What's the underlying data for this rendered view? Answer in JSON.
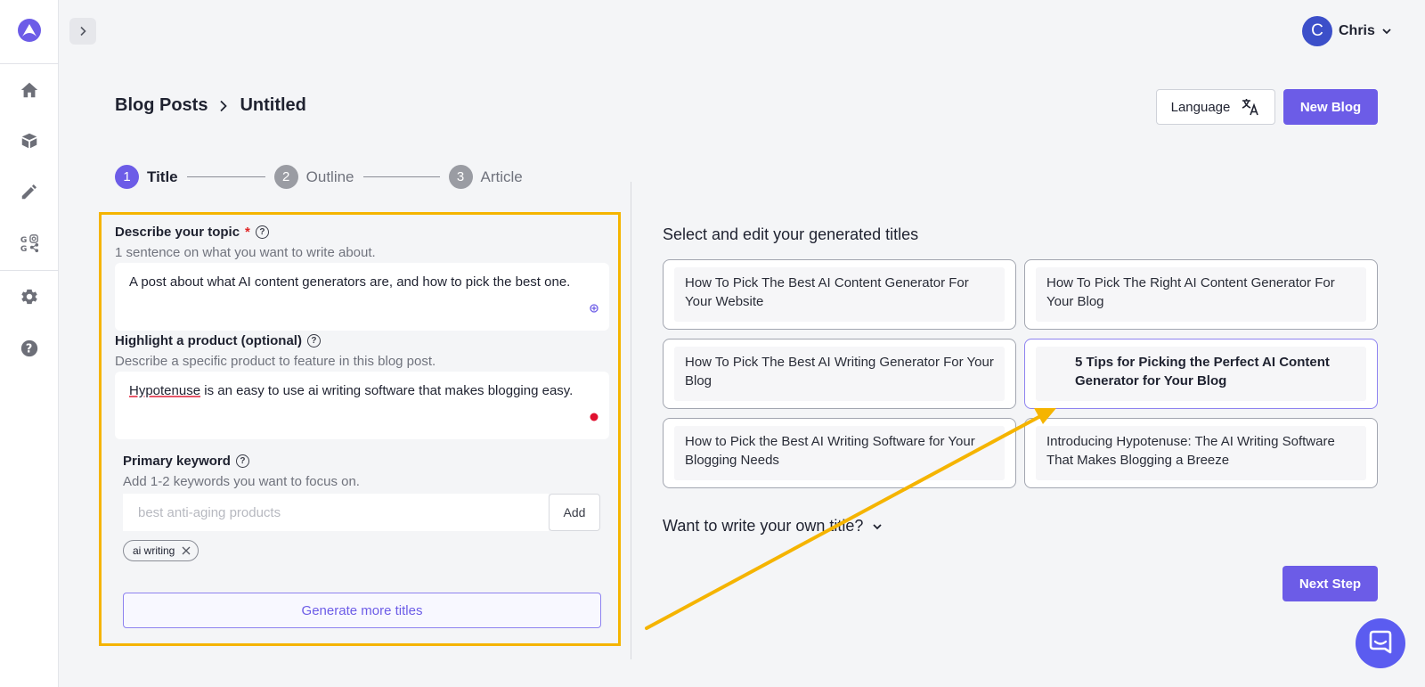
{
  "user": {
    "initial": "C",
    "name": "Chris"
  },
  "breadcrumb": {
    "parent": "Blog Posts",
    "current": "Untitled"
  },
  "header": {
    "language_label": "Language",
    "new_blog_label": "New Blog"
  },
  "steps": [
    {
      "number": "1",
      "label": "Title"
    },
    {
      "number": "2",
      "label": "Outline"
    },
    {
      "number": "3",
      "label": "Article"
    }
  ],
  "form": {
    "topic": {
      "label": "Describe your topic",
      "required_mark": "*",
      "hint": "1 sentence on what you want to write about.",
      "value": "A post about what AI content generators are, and how to pick the best one."
    },
    "product": {
      "label": "Highlight a product (optional)",
      "hint": "Describe a specific product to feature in this blog post.",
      "value_brand": "Hypotenuse",
      "value_rest": " is an easy to use ai writing software that makes blogging easy."
    },
    "keyword": {
      "label": "Primary keyword",
      "hint": "Add 1-2 keywords you want to focus on.",
      "placeholder": "best anti-aging products",
      "add_label": "Add",
      "chips": [
        "ai writing"
      ]
    },
    "generate_label": "Generate more titles"
  },
  "titles": {
    "heading": "Select and edit your generated titles",
    "items": [
      "How To Pick The Best AI Content Generator For Your Website",
      "How To Pick The Right AI Content Generator For Your Blog",
      "How To Pick The Best AI Writing Generator For Your Blog",
      "5 Tips for Picking the Perfect AI Content Generator for Your Blog",
      "How to Pick the Best AI Writing Software for Your Blogging Needs",
      "Introducing Hypotenuse: The AI Writing Software That Makes Blogging a Breeze"
    ],
    "selected_index": 3,
    "own_title_label": "Want to write your own title?"
  },
  "next_label": "Next Step",
  "colors": {
    "accent": "#6c5ce7",
    "highlight_border": "#f5b400",
    "avatar": "#3c4fc9"
  }
}
